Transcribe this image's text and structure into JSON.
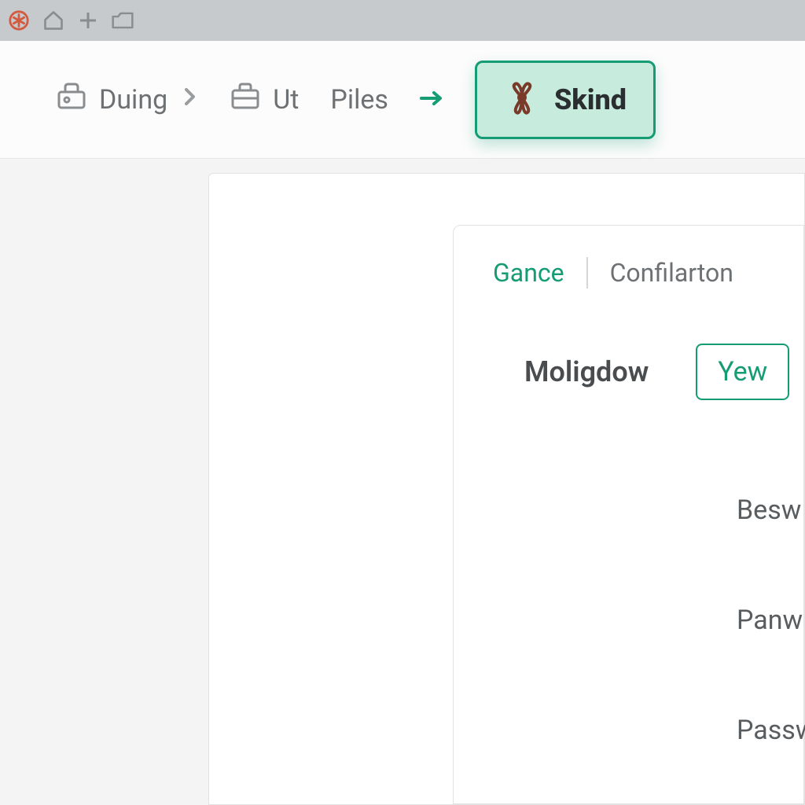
{
  "titlebar": {
    "buttons": [
      "asterisk",
      "home",
      "plus",
      "tab"
    ]
  },
  "breadcrumb": {
    "items": [
      {
        "icon": "toolbox",
        "label": "Duing",
        "chevron": true
      },
      {
        "icon": "briefcase",
        "label": "Ut",
        "chevron": false
      },
      {
        "icon": null,
        "label": "Piles",
        "chevron": false
      }
    ],
    "active": {
      "icon": "gift",
      "label": "Skind"
    }
  },
  "innerTabs": {
    "active": "Gance",
    "other": "Confilarton"
  },
  "form": {
    "heading": "Moligdow",
    "select_value": "Yew",
    "rows": [
      "Besw",
      "Panw",
      "Passw"
    ]
  },
  "colors": {
    "accent": "#159c74",
    "accent_bg": "#c7ecdd"
  }
}
